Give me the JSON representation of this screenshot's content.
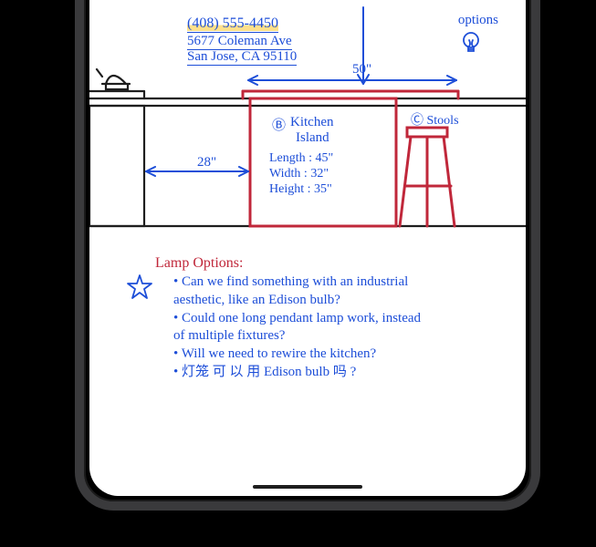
{
  "contact": {
    "phone": "(408) 555-4450",
    "address_line1": "5677 Coleman Ave",
    "address_line2": "San Jose, CA 95110"
  },
  "lamp_label": "options",
  "measurements": {
    "top_width": "50\"",
    "left_gap": "28\""
  },
  "island": {
    "marker": "Ⓑ",
    "name_line1": "Kitchen",
    "name_line2": "Island",
    "length": "Length : 45\"",
    "width": "Width : 32\"",
    "height": "Height : 35\""
  },
  "stools": {
    "marker": "Ⓒ",
    "label": "Stools"
  },
  "section_title": "Lamp Options:",
  "bullets": [
    "• Can we find something with an industrial",
    "  aesthetic, like an Edison bulb?",
    "• Could one long pendant lamp work, instead",
    "  of multiple fixtures?",
    "• Will we need to rewire the kitchen?",
    "• 灯笼 可 以 用 Edison bulb 吗 ?"
  ]
}
